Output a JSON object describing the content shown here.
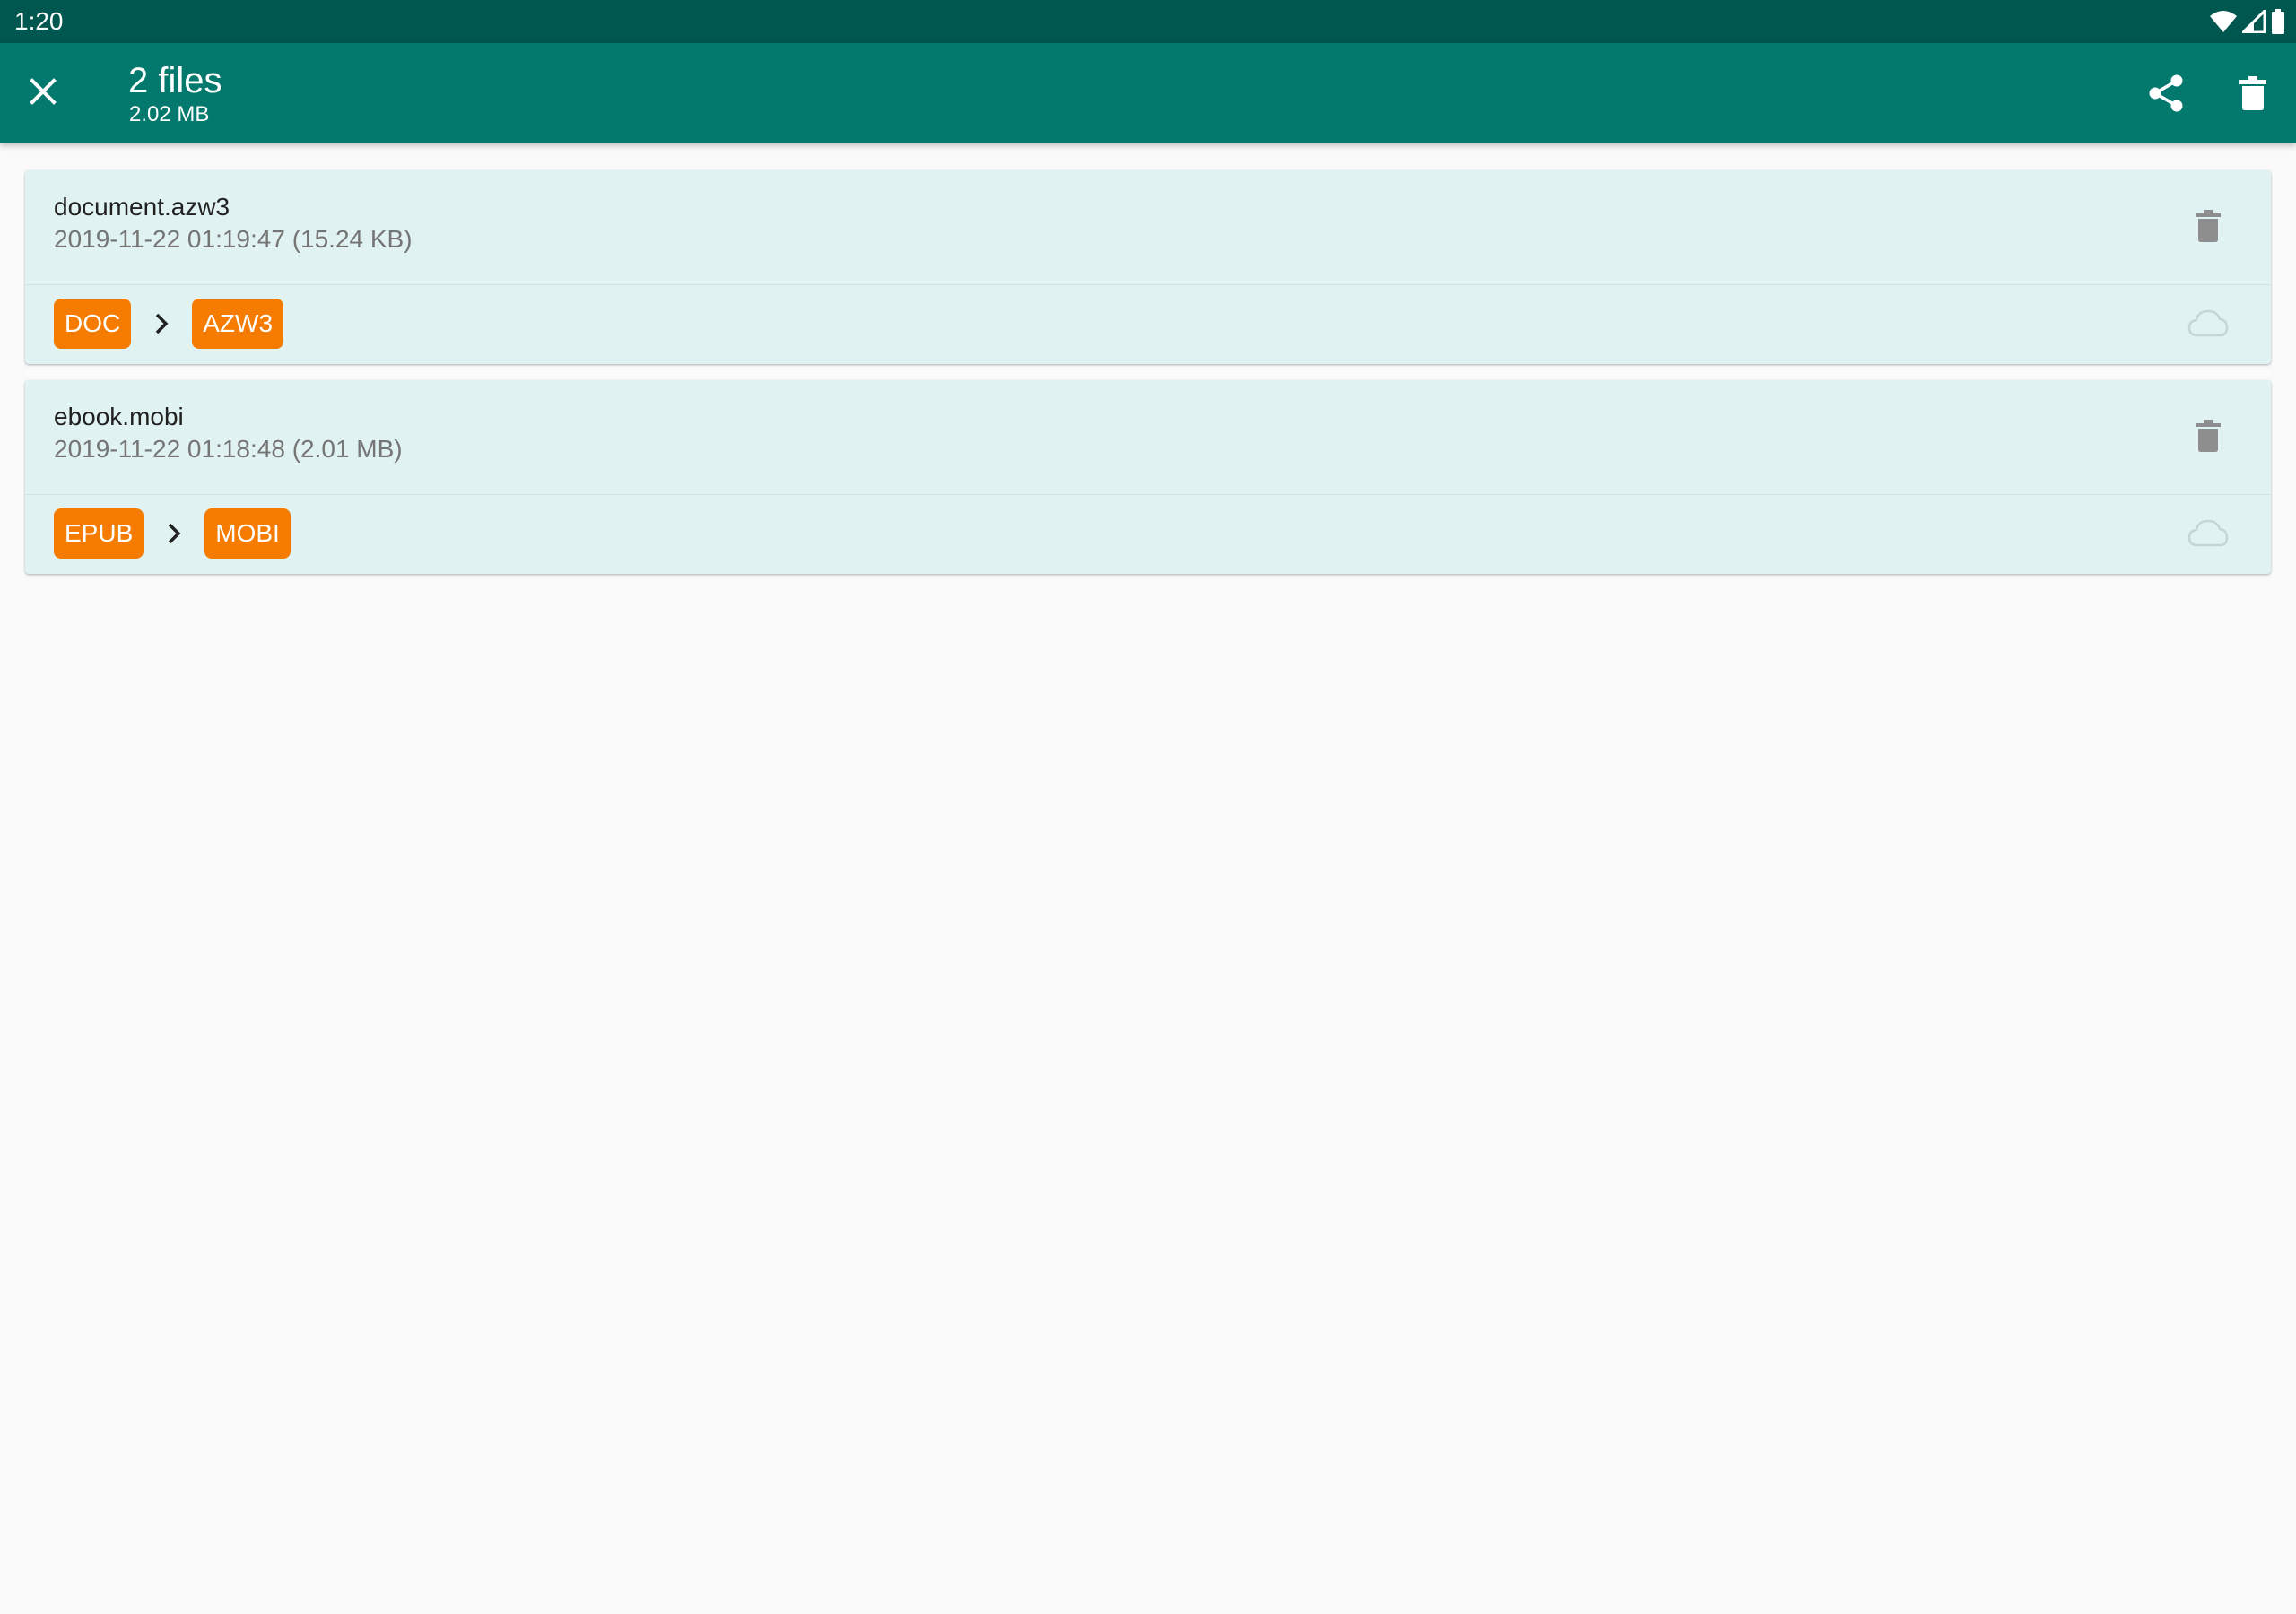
{
  "status_bar": {
    "time": "1:20",
    "icons": [
      "wifi-icon",
      "signal-icon",
      "battery-icon"
    ]
  },
  "app_bar": {
    "title": "2 files",
    "subtitle": "2.02 MB",
    "icons": [
      "close-icon",
      "share-icon",
      "trash-icon"
    ]
  },
  "files": [
    {
      "name": "document.azw3",
      "meta": "2019-11-22 01:19:47 (15.24 KB)",
      "from_format": "DOC",
      "to_format": "AZW3"
    },
    {
      "name": "ebook.mobi",
      "meta": "2019-11-22 01:18:48 (2.01 MB)",
      "from_format": "EPUB",
      "to_format": "MOBI"
    }
  ],
  "colors": {
    "status_bar": "#00574f",
    "app_bar": "#03796d",
    "card_background": "#e0f2f1",
    "badge": "#f57c00",
    "page_background": "#fafafa"
  }
}
